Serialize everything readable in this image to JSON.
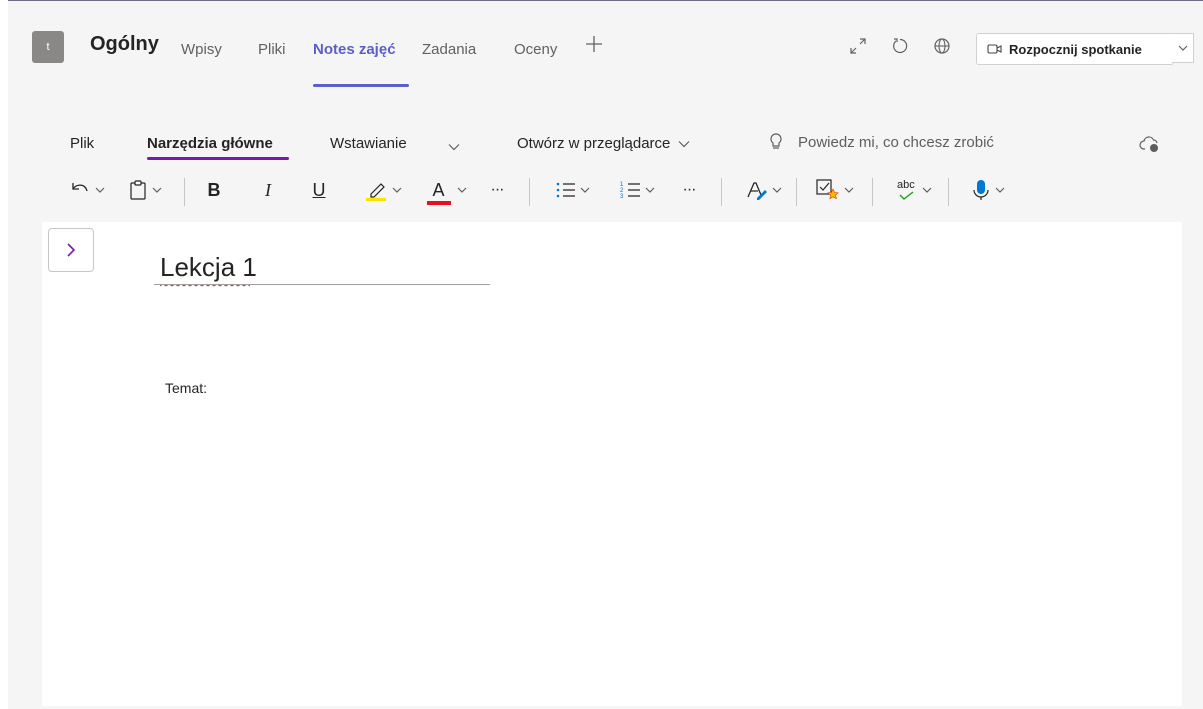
{
  "header": {
    "avatar_letter": "t",
    "channel_name": "Ogólny",
    "tabs": [
      {
        "label": "Wpisy"
      },
      {
        "label": "Pliki"
      },
      {
        "label": "Notes zajęć"
      },
      {
        "label": "Zadania"
      },
      {
        "label": "Oceny"
      }
    ],
    "active_tab": "Notes zajęć",
    "meeting_button_label": "Rozpocznij spotkanie"
  },
  "ribbon": {
    "tabs": [
      {
        "label": "Plik"
      },
      {
        "label": "Narzędzia główne"
      },
      {
        "label": "Wstawianie"
      },
      {
        "label": "Otwórz w przeglądarce"
      }
    ],
    "active_tab": "Narzędzia główne",
    "search_text": "Powiedz mi, co chcesz zrobić",
    "toolbar": {
      "bold": "B",
      "italic": "I",
      "underline": "U",
      "font_color_letter": "A",
      "spelling_label": "abc",
      "more": "···"
    },
    "colors": {
      "highlight": "#fde300",
      "font_color": "#e81123",
      "accent": "#7719aa",
      "teams_accent": "#5b5fc7"
    }
  },
  "page": {
    "title": "Lekcja 1",
    "body_text": "Temat:"
  }
}
